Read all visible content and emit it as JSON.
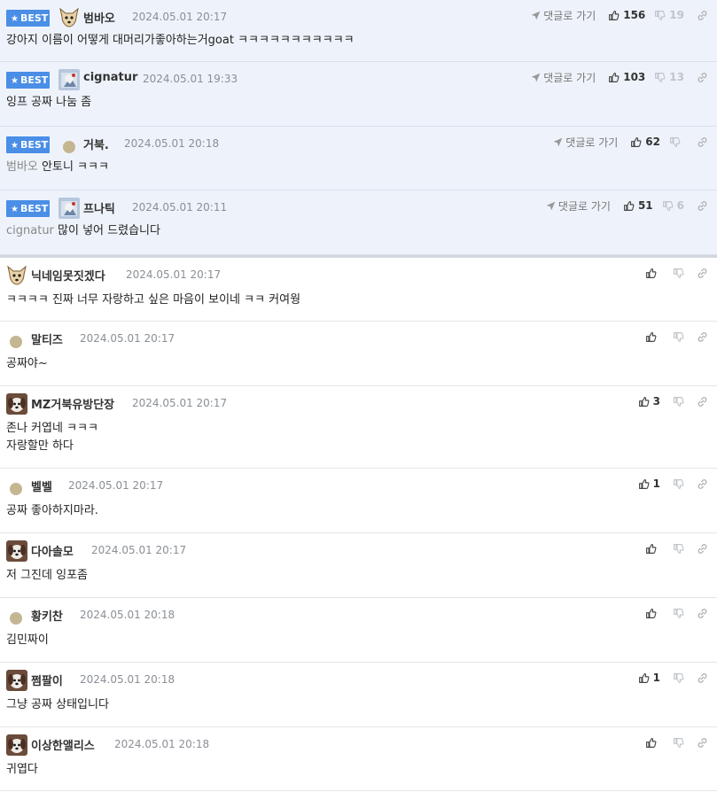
{
  "best_label": "BEST",
  "reply_label": "댓글로 가기",
  "best_comments": [
    {
      "nick": "범바오",
      "date": "2024.05.01 20:17",
      "text": "강아지 이름이 어떻게 대머리가좋아하는거goat ㅋㅋㅋㅋㅋㅋㅋㅋㅋㅋㅋ",
      "mention": "",
      "up": "156",
      "down": "19",
      "avatar": "dog"
    },
    {
      "nick": "cignatur",
      "date": "2024.05.01 19:33",
      "text": "잉프 공짜 나눔 좀",
      "mention": "",
      "up": "103",
      "down": "13",
      "avatar": "photo"
    },
    {
      "nick": "거북.",
      "date": "2024.05.01 20:18",
      "text": "안토니 ㅋㅋㅋ",
      "mention": "범바오",
      "up": "62",
      "down": "",
      "avatar": "dot"
    },
    {
      "nick": "프나틱",
      "date": "2024.05.01 20:11",
      "text": "많이 넣어 드렸습니다",
      "mention": "cignatur",
      "up": "51",
      "down": "6",
      "avatar": "photo"
    }
  ],
  "comments": [
    {
      "nick": "닉네임못짓겠다",
      "date": "2024.05.01 20:17",
      "lines": [
        "ㅋㅋㅋㅋ 진짜 너무 자랑하고 싶은 마음이 보이네 ㅋㅋ 커여웡"
      ],
      "up": "",
      "avatar": "dog"
    },
    {
      "nick": "말티즈",
      "date": "2024.05.01 20:17",
      "lines": [
        "공짜야~"
      ],
      "up": "",
      "avatar": "dot"
    },
    {
      "nick": "MZ거북유방단장",
      "date": "2024.05.01 20:17",
      "lines": [
        "존나 커엽네 ㅋㅋㅋ",
        "자랑할만 하다"
      ],
      "up": "3",
      "avatar": "puppy"
    },
    {
      "nick": "벨벨",
      "date": "2024.05.01 20:17",
      "lines": [
        "공짜 좋아하지마라."
      ],
      "up": "1",
      "avatar": "dot"
    },
    {
      "nick": "다아솔모",
      "date": "2024.05.01 20:17",
      "lines": [
        "저 그진데 잉포좀"
      ],
      "up": "",
      "avatar": "puppy"
    },
    {
      "nick": "황키찬",
      "date": "2024.05.01 20:18",
      "lines": [
        "김민짜이"
      ],
      "up": "",
      "avatar": "dot"
    },
    {
      "nick": "쩜팔이",
      "date": "2024.05.01 20:18",
      "lines": [
        "그냥 공짜 상태입니다"
      ],
      "up": "1",
      "avatar": "puppy"
    },
    {
      "nick": "이상한앨리스",
      "date": "2024.05.01 20:18",
      "lines": [
        "귀엽다"
      ],
      "up": "",
      "avatar": "puppy"
    }
  ],
  "colors": {
    "best_badge": "#4a8ee6",
    "best_bg": "#eef3fb",
    "date": "#8a8f96"
  },
  "icons": {
    "reply": "send-arrow-icon",
    "up": "thumbs-up-icon",
    "down": "thumbs-down-icon",
    "link": "link-icon"
  }
}
